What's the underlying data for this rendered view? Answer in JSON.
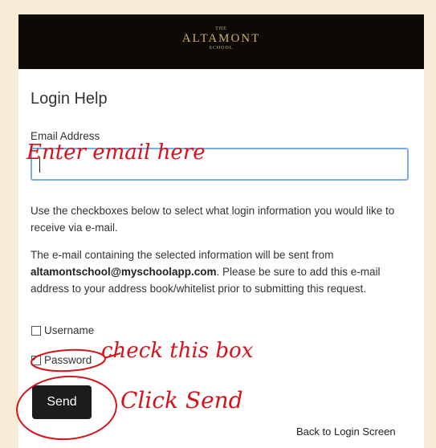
{
  "header": {
    "logo_small_top": "THE",
    "logo_name": "ALTAMONT",
    "logo_small_bottom": "SCHOOL"
  },
  "form": {
    "title": "Login Help",
    "email_label": "Email Address",
    "email_value": "",
    "instructions": "Use the checkboxes below to select what login information you would like to receive via e-mail.",
    "notice_prefix": "The e-mail containing the selected information will be sent from",
    "notice_email": "altamontschool@myschoolapp.com",
    "notice_suffix": ". Please be sure to add this e-mail address to your address book/whitelist prior to submitting this request.",
    "options": [
      {
        "label": "Username",
        "checked": false
      },
      {
        "label": "Password",
        "checked": true
      }
    ],
    "send_label": "Send",
    "back_link": "Back to Login Screen"
  },
  "annotations": {
    "email_note": "Enter email here",
    "checkbox_note": "check this box",
    "send_note": "Click Send",
    "ink_color": "#d4141c"
  }
}
